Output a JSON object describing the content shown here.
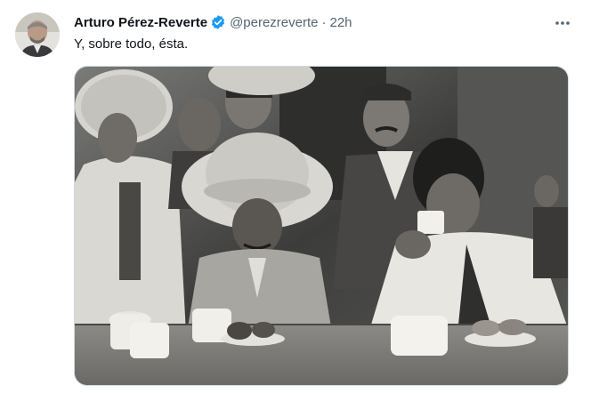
{
  "tweet": {
    "author_name": "Arturo Pérez-Reverte",
    "handle": "@perezreverte",
    "separator": "·",
    "timestamp": "22h",
    "text": "Y, sobre todo, ésta.",
    "verified_color": "#1d9bf0",
    "more_icon": "more-horizontal-icon",
    "media": {
      "kind": "photo",
      "style": "black-and-white"
    }
  }
}
